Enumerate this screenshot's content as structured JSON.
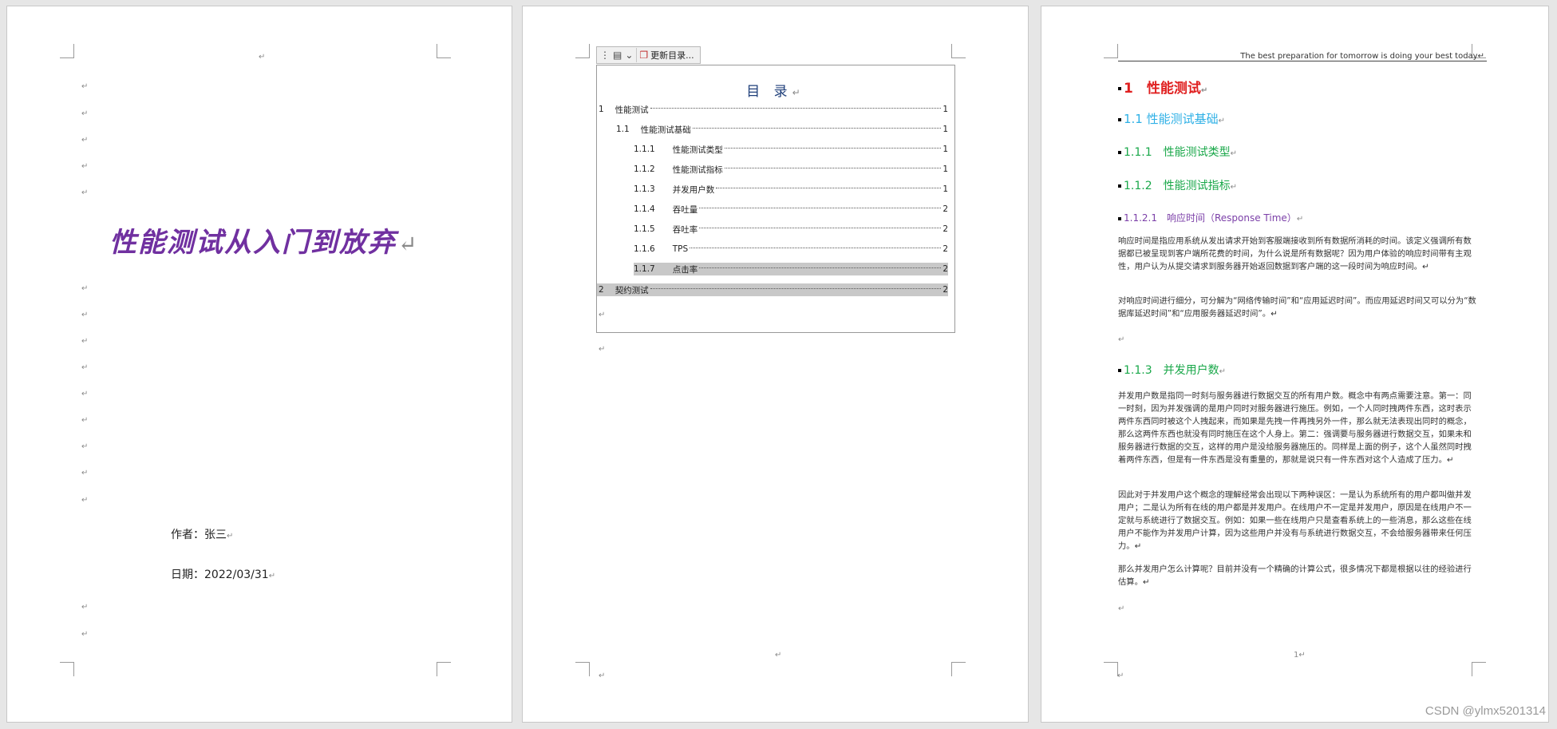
{
  "page1": {
    "title": "性能测试从入门到放弃",
    "author": "作者：张三",
    "date": "日期：2022/03/31"
  },
  "page2": {
    "toolbar": {
      "update_label": "更新目录..."
    },
    "toc_title": "目 录",
    "toc": [
      {
        "num": "1",
        "text": "性能测试",
        "page": "1"
      },
      {
        "num": "1.1",
        "text": "性能测试基础",
        "page": "1"
      },
      {
        "num": "1.1.1",
        "text": "性能测试类型",
        "page": "1"
      },
      {
        "num": "1.1.2",
        "text": "性能测试指标",
        "page": "1"
      },
      {
        "num": "1.1.3",
        "text": "并发用户数",
        "page": "1"
      },
      {
        "num": "1.1.4",
        "text": "吞吐量",
        "page": "2"
      },
      {
        "num": "1.1.5",
        "text": "吞吐率",
        "page": "2"
      },
      {
        "num": "1.1.6",
        "text": "TPS",
        "page": "2"
      },
      {
        "num": "1.1.7",
        "text": "点击率",
        "page": "2"
      },
      {
        "num": "2",
        "text": "契约测试",
        "page": "2"
      }
    ]
  },
  "page3": {
    "header": "The best preparation for tomorrow is doing your best today",
    "h1": "1　性能测试",
    "h2": "1.1 性能测试基础",
    "h3a": "1.1.1　性能测试类型",
    "h3b": "1.1.2　性能测试指标",
    "h4": "1.1.2.1　响应时间（Response Time）",
    "p1": "响应时间是指应用系统从发出请求开始到客服端接收到所有数据所消耗的时间。该定义强调所有数据都已被呈现到客户端所花费的时间，为什么说是所有数据呢？因为用户体验的响应时间带有主观性，用户认为从提交请求到服务器开始返回数据到客户端的这一段时间为响应时间。",
    "p2": "对响应时间进行细分，可分解为“网络传输时间”和“应用延迟时间”。而应用延迟时间又可以分为“数据库延迟时间”和“应用服务器延迟时间”。",
    "h3c": "1.1.3　并发用户数",
    "p3": "并发用户数是指同一时刻与服务器进行数据交互的所有用户数。概念中有两点需要注意。第一：同一时刻，因为并发强调的是用户同时对服务器进行施压。例如，一个人同时拽两件东西，这时表示两件东西同时被这个人拽起来，而如果是先拽一件再拽另外一件，那么就无法表现出同时的概念，那么这两件东西也就没有同时施压在这个人身上。第二：强调要与服务器进行数据交互，如果未和服务器进行数据的交互，这样的用户是没给服务器施压的。同样是上面的例子，这个人虽然同时拽着两件东西，但是有一件东西是没有重量的，那就是说只有一件东西对这个人造成了压力。",
    "p4": "因此对于并发用户这个概念的理解经常会出现以下两种误区：一是认为系统所有的用户都叫做并发用户；二是认为所有在线的用户都是并发用户。在线用户不一定是并发用户，原因是在线用户不一定就与系统进行了数据交互。例如：如果一些在线用户只是查看系统上的一些消息，那么这些在线用户不能作为并发用户计算，因为这些用户并没有与系统进行数据交互，不会给服务器带来任何压力。",
    "p5": "那么并发用户怎么计算呢？目前并没有一个精确的计算公式，很多情况下都是根据以往的经验进行估算。",
    "footer_page": "1"
  },
  "watermark": "CSDN @ylmx5201314"
}
